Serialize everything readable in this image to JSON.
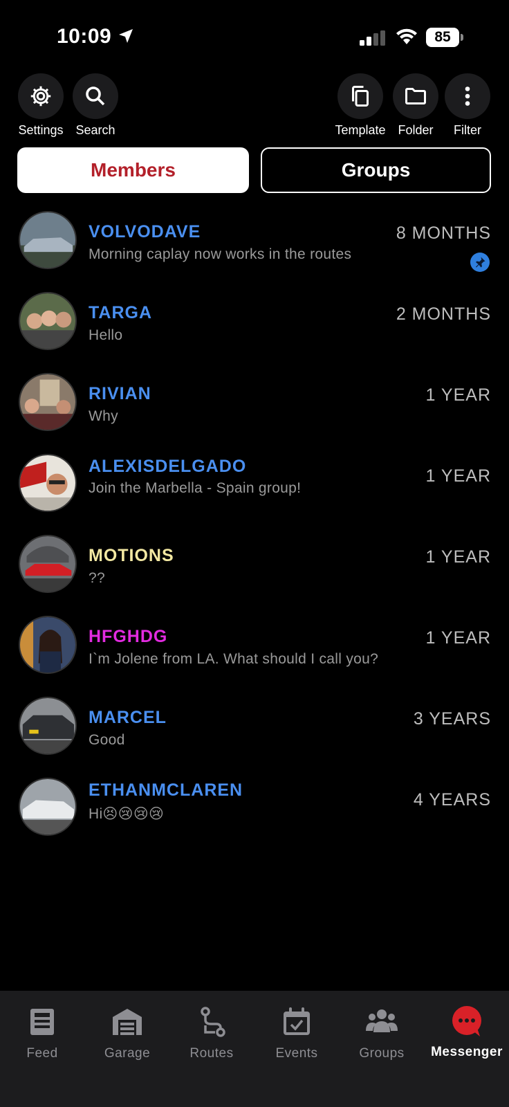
{
  "status_bar": {
    "time": "10:09",
    "battery": "85"
  },
  "toolbar": {
    "settings_label": "Settings",
    "search_label": "Search",
    "template_label": "Template",
    "folder_label": "Folder",
    "filter_label": "Filter"
  },
  "tabs": {
    "members": "Members",
    "groups": "Groups",
    "active": "Members"
  },
  "colors": {
    "accent_red": "#b3202a",
    "name_blue": "#4a8ff0",
    "name_yellow": "#f3e8a2",
    "name_magenta": "#e22be0",
    "pin_blue": "#2f7fde",
    "messenger_red": "#d92128"
  },
  "conversations": [
    {
      "name": "VOLVODAVE",
      "message": "Morning caplay now works in the routes",
      "time": "8 MONTHS",
      "pinned": true,
      "name_color": "#4a8ff0"
    },
    {
      "name": "TARGA",
      "message": "Hello",
      "time": "2 MONTHS",
      "name_color": "#4a8ff0"
    },
    {
      "name": "RIVIAN",
      "message": "Why",
      "time": "1 YEAR",
      "name_color": "#4a8ff0"
    },
    {
      "name": "ALEXISDELGADO",
      "message": "Join the Marbella - Spain group!",
      "time": "1 YEAR",
      "name_color": "#4a8ff0"
    },
    {
      "name": "MOTIONS",
      "message": "??",
      "time": "1 YEAR",
      "name_color": "#f3e8a2"
    },
    {
      "name": "HFGHDG",
      "message": "I`m Jolene from LA. What should I call you?",
      "time": "1 YEAR",
      "name_color": "#e22be0"
    },
    {
      "name": "MARCEL",
      "message": "Good",
      "time": "3 YEARS",
      "name_color": "#4a8ff0"
    },
    {
      "name": "ETHANMCLAREN",
      "message": "Hi😣😢😢😢",
      "time": "4 YEARS",
      "name_color": "#4a8ff0"
    }
  ],
  "bottom_nav": {
    "feed": "Feed",
    "garage": "Garage",
    "routes": "Routes",
    "events": "Events",
    "groups": "Groups",
    "messenger": "Messenger",
    "active": "Messenger"
  },
  "icons": [
    "location-arrow-icon",
    "signal-icon",
    "wifi-icon",
    "gear-icon",
    "search-icon",
    "copy-icon",
    "folder-icon",
    "more-vertical-icon",
    "pin-icon",
    "feed-icon",
    "garage-icon",
    "routes-icon",
    "events-icon",
    "groups-icon",
    "messenger-icon"
  ]
}
